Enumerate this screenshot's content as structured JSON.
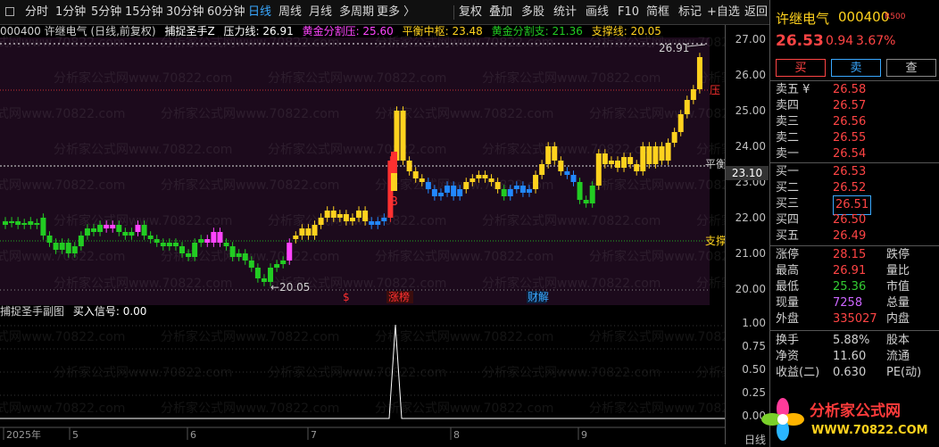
{
  "toolbar": {
    "periods": [
      "分时",
      "1分钟",
      "5分钟",
      "15分钟",
      "30分钟",
      "60分钟",
      "日线",
      "周线",
      "月线",
      "多周期",
      "更多 〉"
    ],
    "active_period": "日线",
    "actions": [
      "复权",
      "叠加",
      "多股",
      "统计",
      "画线",
      "F10",
      "简框",
      "标记",
      "+自选",
      "返回"
    ]
  },
  "chart": {
    "info_code": "000400 许继电气 (日线,前复权)",
    "indicator_name": "捕捉圣手Z",
    "pressure": "压力线: 26.91",
    "gold_press": "黄金分割压: 25.60",
    "balance": "平衡中枢: 23.48",
    "gold_support": "黄金分割支: 21.36",
    "support": "支撑线: 20.05",
    "high_label": "26.91",
    "low_label": "←20.05",
    "balance_tag": "平衡",
    "support_tag": "支撑",
    "press_tag": "压",
    "buy_mark": "B",
    "current_price_tag": "23.10",
    "event_dollar": "$",
    "event_zt": "涨榜",
    "event_cj": "财解",
    "sub_title": "捕捉圣手副图",
    "sub_signal": "买入信号: 0.00",
    "date_labels": [
      "2025年",
      "5",
      "6",
      "7",
      "8",
      "9"
    ],
    "date_tail": "日线",
    "y_ticks": [
      "27.00",
      "26.00",
      "25.00",
      "24.00",
      "23.00",
      "22.00",
      "21.00",
      "20.00"
    ],
    "sub_ticks": [
      "1.00",
      "0.75",
      "0.50",
      "0.25",
      "0.00"
    ],
    "watermark": "分析家公式网www.70822.com"
  },
  "quote": {
    "name": "许继电气",
    "code": "000400",
    "badge": "R500",
    "price": "26.53",
    "change": "0.94",
    "change_pct": "3.67%",
    "buy_btn": "买",
    "sell_btn": "卖",
    "query_btn": "查",
    "asks": [
      {
        "label": "卖五 ¥",
        "price": "26.58"
      },
      {
        "label": "卖四",
        "price": "26.57"
      },
      {
        "label": "卖三",
        "price": "26.56"
      },
      {
        "label": "卖二",
        "price": "26.55"
      },
      {
        "label": "卖一",
        "price": "26.54"
      }
    ],
    "bids": [
      {
        "label": "买一",
        "price": "26.53"
      },
      {
        "label": "买二",
        "price": "26.52"
      },
      {
        "label": "买三",
        "price": "26.51"
      },
      {
        "label": "买四",
        "price": "26.50"
      },
      {
        "label": "买五",
        "price": "26.49"
      }
    ],
    "stats": [
      {
        "l1": "涨停",
        "v1": "28.15",
        "l2": "跌停",
        "c": "#ff4444"
      },
      {
        "l1": "最高",
        "v1": "26.91",
        "l2": "量比",
        "c": "#ff4444"
      },
      {
        "l1": "最低",
        "v1": "25.36",
        "l2": "市值",
        "c": "#33cc33"
      },
      {
        "l1": "现量",
        "v1": "7258",
        "l2": "总量",
        "c": "#cc66ff"
      },
      {
        "l1": "外盘",
        "v1": "335027",
        "l2": "内盘",
        "c": "#ff4444"
      }
    ],
    "stats2": [
      {
        "l1": "换手",
        "v1": "5.88%",
        "l2": "股本"
      },
      {
        "l1": "净资",
        "v1": "11.60",
        "l2": "流通"
      },
      {
        "l1": "收益(二)",
        "v1": "0.630",
        "l2": "PE(动)"
      }
    ],
    "logo_text": "分析家公式网",
    "logo_url": "WWW.70822.COM"
  },
  "colors": {
    "up": "#ff3030",
    "down": "#00c8c8",
    "gold": "#ffd21e",
    "green": "#22cc22",
    "magenta": "#ff44ff",
    "blue": "#2288ff"
  }
}
